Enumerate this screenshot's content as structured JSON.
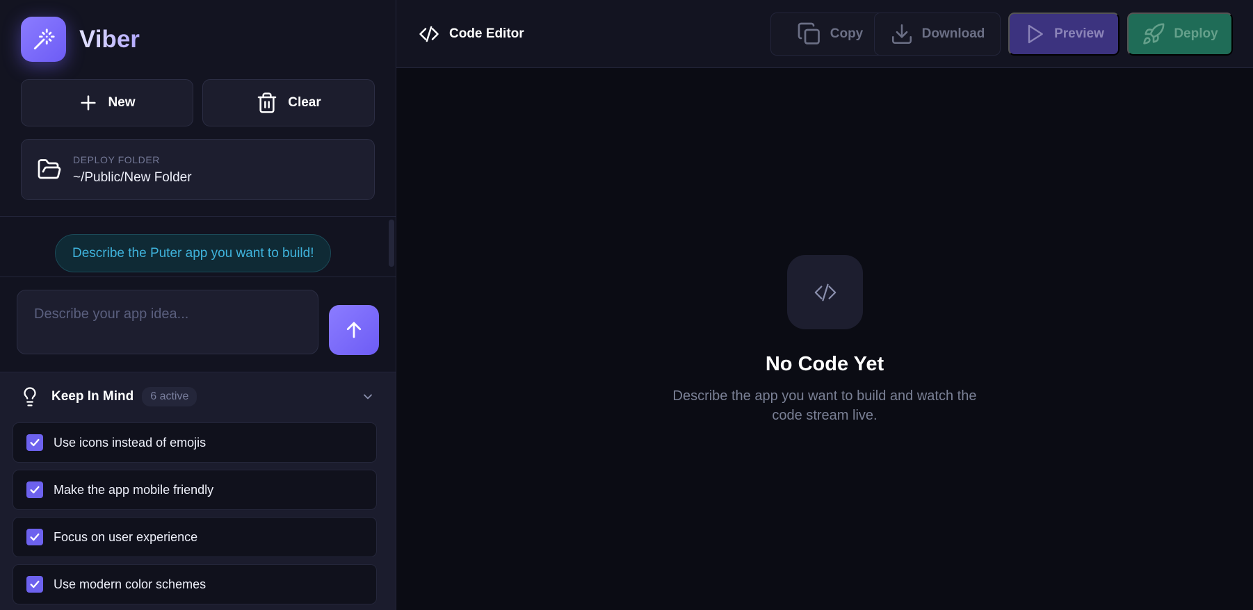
{
  "sidebar": {
    "brand": {
      "name": "Viber",
      "icon": "magic-wand-icon"
    },
    "actions": {
      "new_label": "New",
      "clear_label": "Clear"
    },
    "deploy_folder": {
      "label": "DEPLOY FOLDER",
      "path": "~/Public/New Folder"
    },
    "chat": {
      "hint": "Describe the Puter app you want to build!"
    },
    "prompt": {
      "placeholder": "Describe your app idea...",
      "value": ""
    },
    "keep_in_mind": {
      "title": "Keep In Mind",
      "badge": "6 active",
      "items": [
        {
          "label": "Use icons instead of emojis",
          "checked": true
        },
        {
          "label": "Make the app mobile friendly",
          "checked": true
        },
        {
          "label": "Focus on user experience",
          "checked": true
        },
        {
          "label": "Use modern color schemes",
          "checked": true
        }
      ]
    }
  },
  "editor": {
    "title": "Code Editor",
    "toolbar": {
      "copy_label": "Copy",
      "download_label": "Download",
      "preview_label": "Preview",
      "deploy_label": "Deploy"
    },
    "empty_state": {
      "title": "No Code Yet",
      "description": "Describe the app you want to build and watch the code stream live."
    }
  },
  "colors": {
    "accent": "#7b6cf8",
    "background": "#0b0c14",
    "sidebar": "#131421",
    "hint_text": "#3fb3dc",
    "deploy_green": "#1f6c57"
  }
}
